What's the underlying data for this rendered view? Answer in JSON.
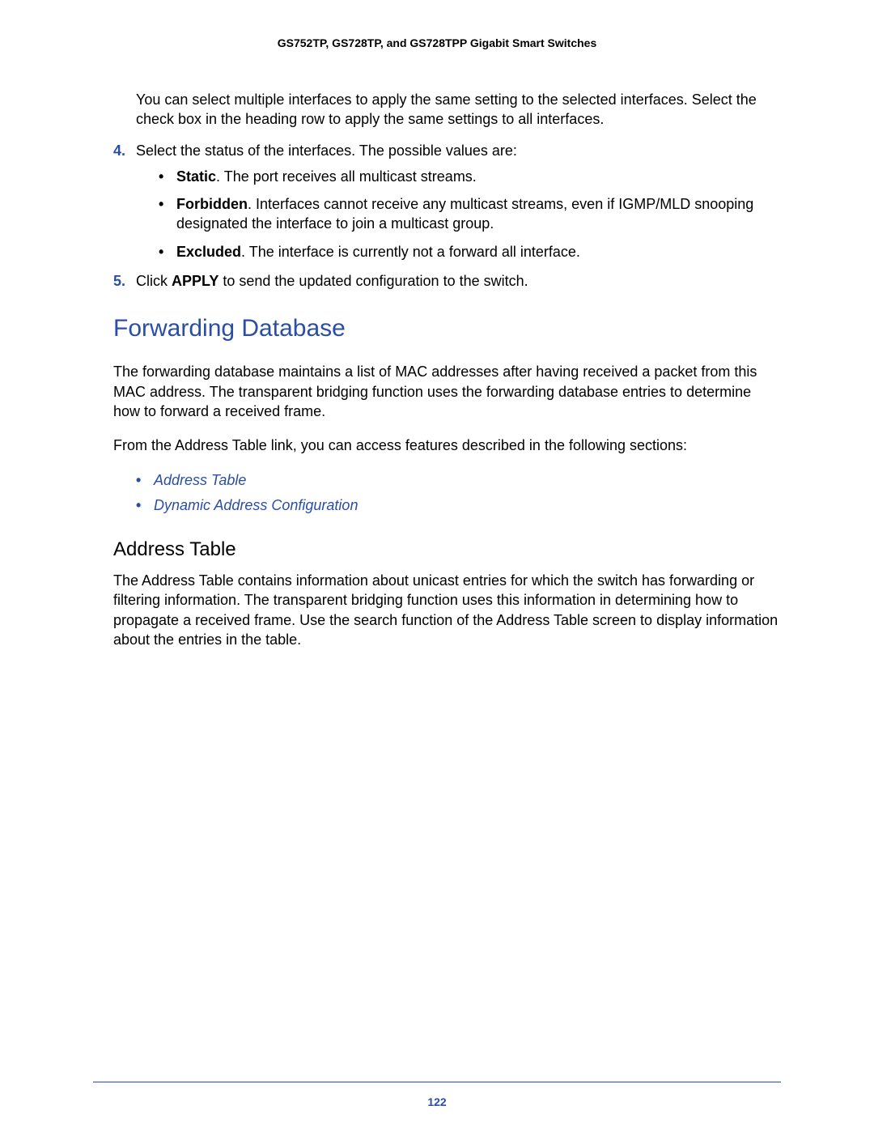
{
  "header": "GS752TP, GS728TP, and GS728TPP Gigabit Smart Switches",
  "intro_para": "You can select multiple interfaces to apply the same setting to the selected interfaces. Select the check box in the heading row to apply the same settings to all interfaces.",
  "step4": {
    "num": "4.",
    "text": "Select the status of the interfaces. The possible values are:",
    "bullets": [
      {
        "label": "Static",
        "desc": ". The port receives all multicast streams."
      },
      {
        "label": "Forbidden",
        "desc": ". Interfaces cannot receive any multicast streams, even if IGMP/MLD snooping designated the interface to join a multicast group."
      },
      {
        "label": "Excluded",
        "desc": ". The interface is currently not a forward all interface."
      }
    ]
  },
  "step5": {
    "num": "5.",
    "prefix": "Click ",
    "bold": "APPLY",
    "suffix": " to send the updated configuration to the switch."
  },
  "section": {
    "heading": "Forwarding Database",
    "p1": "The forwarding database maintains a list of MAC addresses after having received a packet from this MAC address. The transparent bridging function uses the forwarding database entries to determine how to forward a received frame.",
    "p2": "From the Address Table link, you can access features described in the following sections:",
    "links": [
      "Address Table",
      "Dynamic Address Configuration"
    ],
    "sub": {
      "heading": "Address Table",
      "text": "The Address Table contains information about unicast entries for which the switch has forwarding or filtering information. The transparent bridging function uses this information in determining how to propagate a received frame. Use the search function of the Address Table screen to display information about the entries in the table."
    }
  },
  "page_number": "122"
}
